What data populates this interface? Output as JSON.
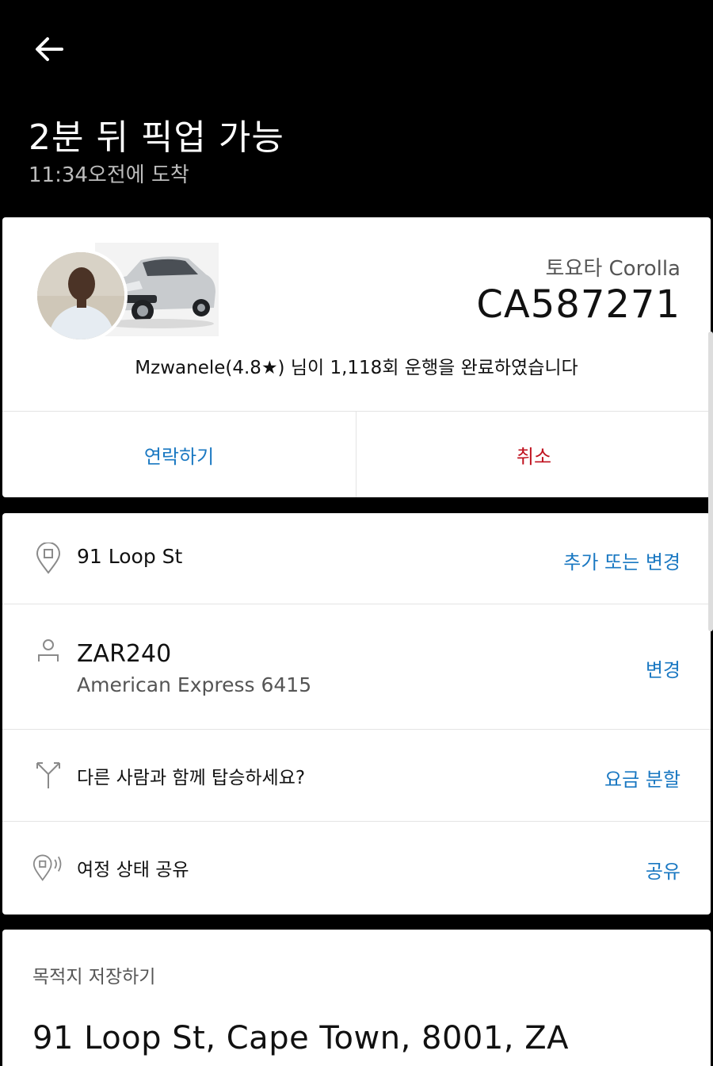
{
  "header": {
    "title": "2분 뒤 픽업 가능",
    "subtitle": "11:34오전에 도착",
    "back_icon": "arrow-left-icon"
  },
  "driver": {
    "car_model": "토요타 Corolla",
    "plate": "CA587271",
    "info": "Mzwanele(4.8★) 님이 1,118회 운행을 완료하였습니다",
    "contact_label": "연락하기",
    "cancel_label": "취소",
    "colors": {
      "contact": "#1a78c2",
      "cancel": "#c0121f"
    }
  },
  "trip": {
    "pickup": {
      "icon": "map-pin-icon",
      "text": "91 Loop St",
      "action": "추가 또는 변경"
    },
    "payment": {
      "icon": "person-icon",
      "amount": "ZAR240",
      "card": "American Express 6415",
      "action": "변경"
    },
    "split": {
      "icon": "split-fare-icon",
      "text": "다른 사람과 함께 탑승하세요?",
      "action": "요금 분할"
    },
    "share": {
      "icon": "share-location-icon",
      "text": "여정 상태 공유",
      "action": "공유"
    }
  },
  "destination": {
    "label": "목적지 저장하기",
    "address": "91 Loop St, Cape Town, 8001, ZA"
  }
}
